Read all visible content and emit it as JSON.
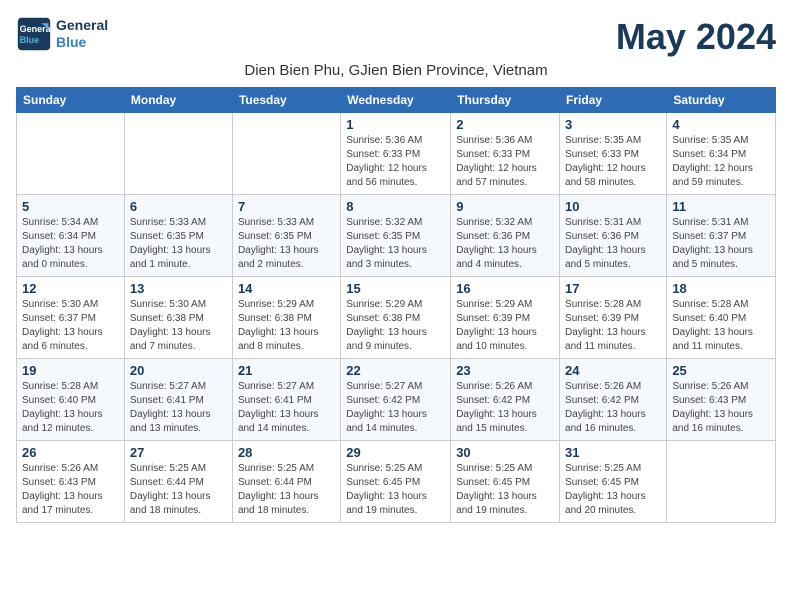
{
  "header": {
    "logo_line1": "General",
    "logo_line2": "Blue",
    "month": "May 2024",
    "location": "Dien Bien Phu, GJien Bien Province, Vietnam"
  },
  "weekdays": [
    "Sunday",
    "Monday",
    "Tuesday",
    "Wednesday",
    "Thursday",
    "Friday",
    "Saturday"
  ],
  "weeks": [
    [
      {
        "day": "",
        "info": ""
      },
      {
        "day": "",
        "info": ""
      },
      {
        "day": "",
        "info": ""
      },
      {
        "day": "1",
        "info": "Sunrise: 5:36 AM\nSunset: 6:33 PM\nDaylight: 12 hours\nand 56 minutes."
      },
      {
        "day": "2",
        "info": "Sunrise: 5:36 AM\nSunset: 6:33 PM\nDaylight: 12 hours\nand 57 minutes."
      },
      {
        "day": "3",
        "info": "Sunrise: 5:35 AM\nSunset: 6:33 PM\nDaylight: 12 hours\nand 58 minutes."
      },
      {
        "day": "4",
        "info": "Sunrise: 5:35 AM\nSunset: 6:34 PM\nDaylight: 12 hours\nand 59 minutes."
      }
    ],
    [
      {
        "day": "5",
        "info": "Sunrise: 5:34 AM\nSunset: 6:34 PM\nDaylight: 13 hours\nand 0 minutes."
      },
      {
        "day": "6",
        "info": "Sunrise: 5:33 AM\nSunset: 6:35 PM\nDaylight: 13 hours\nand 1 minute."
      },
      {
        "day": "7",
        "info": "Sunrise: 5:33 AM\nSunset: 6:35 PM\nDaylight: 13 hours\nand 2 minutes."
      },
      {
        "day": "8",
        "info": "Sunrise: 5:32 AM\nSunset: 6:35 PM\nDaylight: 13 hours\nand 3 minutes."
      },
      {
        "day": "9",
        "info": "Sunrise: 5:32 AM\nSunset: 6:36 PM\nDaylight: 13 hours\nand 4 minutes."
      },
      {
        "day": "10",
        "info": "Sunrise: 5:31 AM\nSunset: 6:36 PM\nDaylight: 13 hours\nand 5 minutes."
      },
      {
        "day": "11",
        "info": "Sunrise: 5:31 AM\nSunset: 6:37 PM\nDaylight: 13 hours\nand 5 minutes."
      }
    ],
    [
      {
        "day": "12",
        "info": "Sunrise: 5:30 AM\nSunset: 6:37 PM\nDaylight: 13 hours\nand 6 minutes."
      },
      {
        "day": "13",
        "info": "Sunrise: 5:30 AM\nSunset: 6:38 PM\nDaylight: 13 hours\nand 7 minutes."
      },
      {
        "day": "14",
        "info": "Sunrise: 5:29 AM\nSunset: 6:38 PM\nDaylight: 13 hours\nand 8 minutes."
      },
      {
        "day": "15",
        "info": "Sunrise: 5:29 AM\nSunset: 6:38 PM\nDaylight: 13 hours\nand 9 minutes."
      },
      {
        "day": "16",
        "info": "Sunrise: 5:29 AM\nSunset: 6:39 PM\nDaylight: 13 hours\nand 10 minutes."
      },
      {
        "day": "17",
        "info": "Sunrise: 5:28 AM\nSunset: 6:39 PM\nDaylight: 13 hours\nand 11 minutes."
      },
      {
        "day": "18",
        "info": "Sunrise: 5:28 AM\nSunset: 6:40 PM\nDaylight: 13 hours\nand 11 minutes."
      }
    ],
    [
      {
        "day": "19",
        "info": "Sunrise: 5:28 AM\nSunset: 6:40 PM\nDaylight: 13 hours\nand 12 minutes."
      },
      {
        "day": "20",
        "info": "Sunrise: 5:27 AM\nSunset: 6:41 PM\nDaylight: 13 hours\nand 13 minutes."
      },
      {
        "day": "21",
        "info": "Sunrise: 5:27 AM\nSunset: 6:41 PM\nDaylight: 13 hours\nand 14 minutes."
      },
      {
        "day": "22",
        "info": "Sunrise: 5:27 AM\nSunset: 6:42 PM\nDaylight: 13 hours\nand 14 minutes."
      },
      {
        "day": "23",
        "info": "Sunrise: 5:26 AM\nSunset: 6:42 PM\nDaylight: 13 hours\nand 15 minutes."
      },
      {
        "day": "24",
        "info": "Sunrise: 5:26 AM\nSunset: 6:42 PM\nDaylight: 13 hours\nand 16 minutes."
      },
      {
        "day": "25",
        "info": "Sunrise: 5:26 AM\nSunset: 6:43 PM\nDaylight: 13 hours\nand 16 minutes."
      }
    ],
    [
      {
        "day": "26",
        "info": "Sunrise: 5:26 AM\nSunset: 6:43 PM\nDaylight: 13 hours\nand 17 minutes."
      },
      {
        "day": "27",
        "info": "Sunrise: 5:25 AM\nSunset: 6:44 PM\nDaylight: 13 hours\nand 18 minutes."
      },
      {
        "day": "28",
        "info": "Sunrise: 5:25 AM\nSunset: 6:44 PM\nDaylight: 13 hours\nand 18 minutes."
      },
      {
        "day": "29",
        "info": "Sunrise: 5:25 AM\nSunset: 6:45 PM\nDaylight: 13 hours\nand 19 minutes."
      },
      {
        "day": "30",
        "info": "Sunrise: 5:25 AM\nSunset: 6:45 PM\nDaylight: 13 hours\nand 19 minutes."
      },
      {
        "day": "31",
        "info": "Sunrise: 5:25 AM\nSunset: 6:45 PM\nDaylight: 13 hours\nand 20 minutes."
      },
      {
        "day": "",
        "info": ""
      }
    ]
  ]
}
